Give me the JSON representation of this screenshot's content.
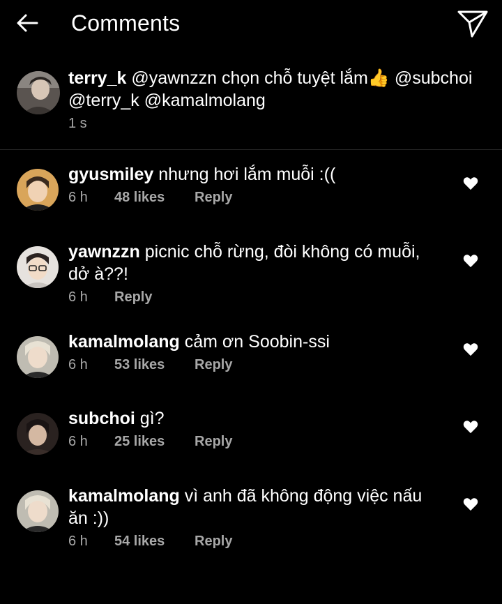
{
  "header": {
    "title": "Comments",
    "back_icon": "arrow-left-icon",
    "share_icon": "paper-plane-icon"
  },
  "caption": {
    "username": "terry_k",
    "text": " @yawnzzn chọn chỗ tuyệt lắm👍 @subchoi @terry_k @kamalmolang",
    "time": "1 s"
  },
  "comments": [
    {
      "username": "gyusmiley",
      "text": " nhưng hơi lắm muỗi :((",
      "time": "6 h",
      "likes": "48 likes",
      "reply": "Reply"
    },
    {
      "username": "yawnzzn",
      "text": " picnic chỗ rừng, đòi không có muỗi, dở à??!",
      "time": "6 h",
      "likes": "",
      "reply": "Reply"
    },
    {
      "username": "kamalmolang",
      "text": " cảm ơn Soobin-ssi",
      "time": "6 h",
      "likes": "53 likes",
      "reply": "Reply"
    },
    {
      "username": "subchoi",
      "text": " gì?",
      "time": "6 h",
      "likes": "25 likes",
      "reply": "Reply"
    },
    {
      "username": "kamalmolang",
      "text": " vì anh đã không động việc nấu ăn :))",
      "time": "6 h",
      "likes": "54 likes",
      "reply": "Reply"
    }
  ],
  "colors": {
    "background": "#000000",
    "text": "#ffffff",
    "muted": "#a8a8a8",
    "divider": "#262626"
  }
}
